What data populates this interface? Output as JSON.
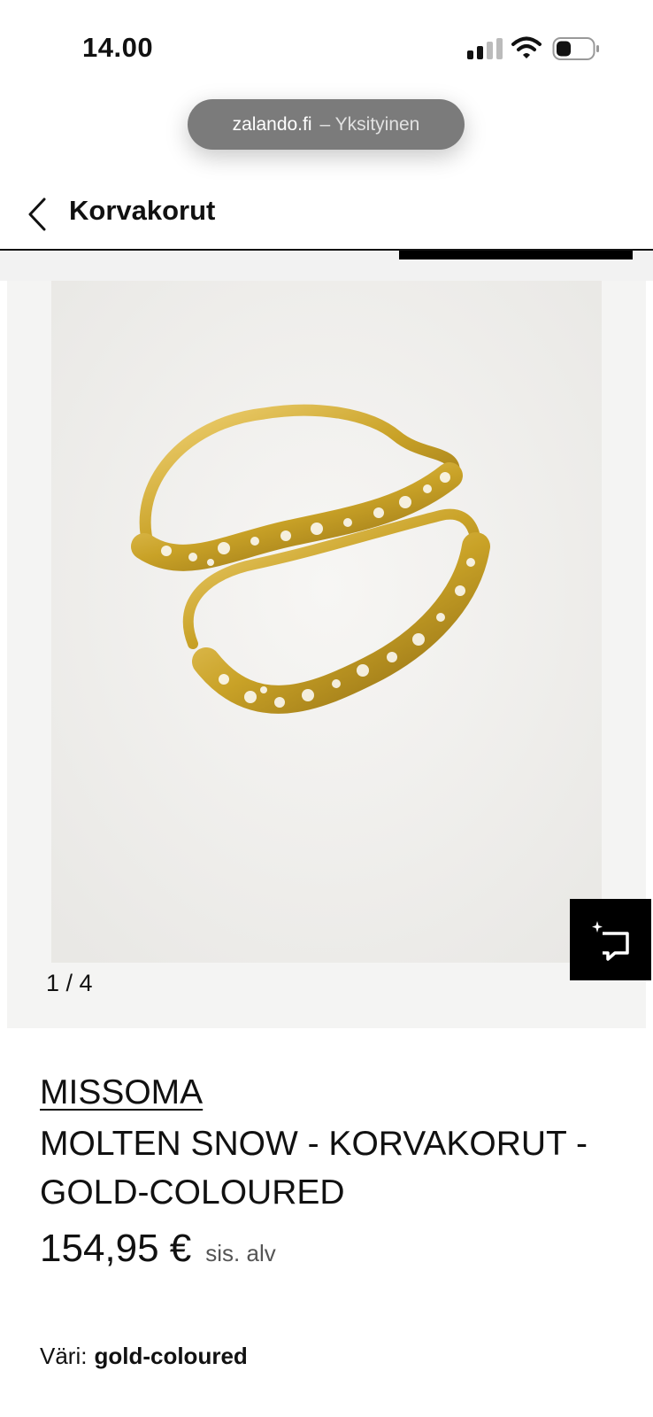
{
  "status_bar": {
    "time": "14.00",
    "icons": [
      "signal-icon",
      "wifi-icon",
      "battery-icon"
    ]
  },
  "browser": {
    "domain": "zalando.fi",
    "mode": "– Yksityinen"
  },
  "header": {
    "title": "Korvakorut",
    "back_icon": "chevron-left-icon"
  },
  "gallery": {
    "counter": "1 / 4",
    "current": 1,
    "total": 4,
    "try_on_icon": "sparkle-crop-icon"
  },
  "product": {
    "brand": "MISSOMA",
    "name": "MOLTEN SNOW - KORVAKORUT - GOLD-COLOURED",
    "price": "154,95 €",
    "vat_note": "sis. alv",
    "color_label": "Väri:",
    "color_value": "gold-coloured"
  },
  "colors": {
    "gold": "#c9a227",
    "image_bg": "#efeeec",
    "accent": "#000000"
  }
}
